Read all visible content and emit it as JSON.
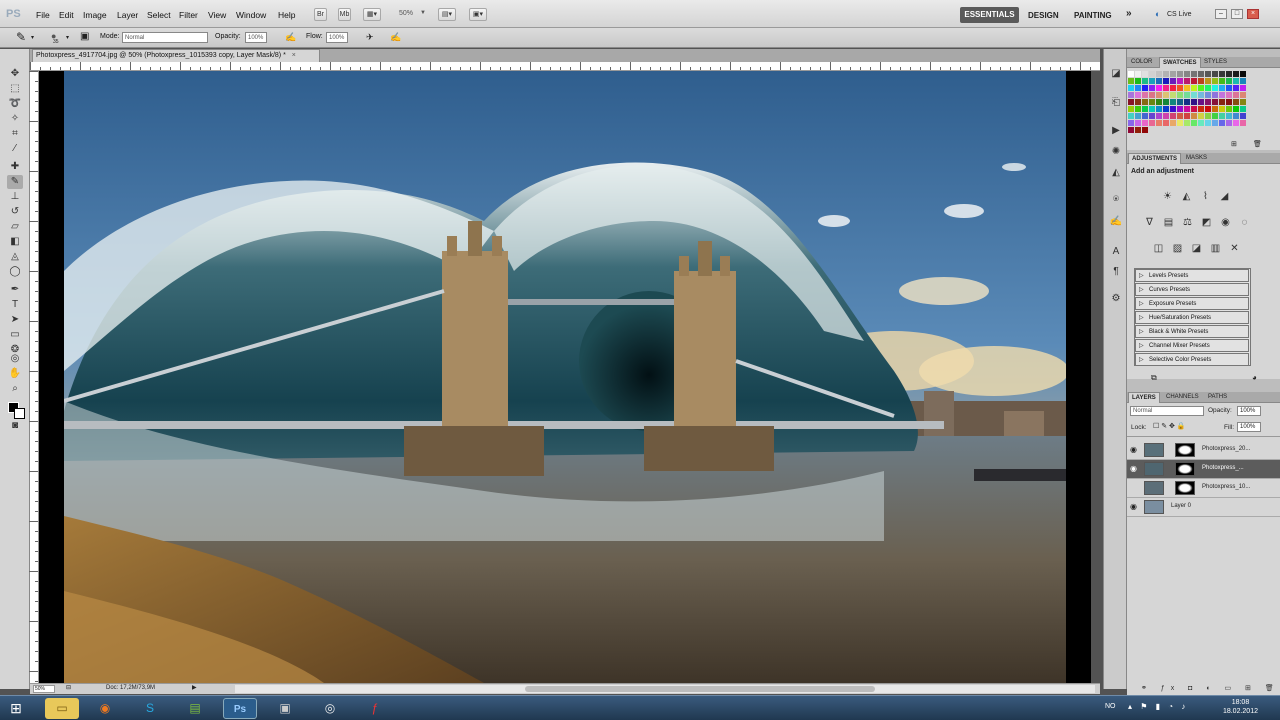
{
  "app": {
    "logo": "PS"
  },
  "menubar": {
    "items": [
      "File",
      "Edit",
      "Image",
      "Layer",
      "Select",
      "Filter",
      "View",
      "Window",
      "Help"
    ],
    "zoom_value": "50%",
    "workspaces": {
      "active": "ESSENTIALS",
      "design": "DESIGN",
      "painting": "PAINTING",
      "more": "»"
    },
    "cs_live": "CS Live"
  },
  "options": {
    "brush_size": "35",
    "mode_label": "Mode:",
    "mode_value": "Normal",
    "opacity_label": "Opacity:",
    "opacity_value": "100%",
    "flow_label": "Flow:",
    "flow_value": "100%"
  },
  "document": {
    "tab_title": "Photoxpress_4917704.jpg @ 50% (Photoxpress_1015393 copy, Layer Mask/8) *",
    "close": "×"
  },
  "status": {
    "zoom": "50%",
    "doc_size": "Doc: 17,2M/73,9M"
  },
  "panels": {
    "color_tabs": [
      "COLOR",
      "SWATCHES",
      "STYLES"
    ],
    "adjust_tabs": [
      "ADJUSTMENTS",
      "MASKS"
    ],
    "adjust_title": "Add an adjustment",
    "presets": [
      "Levels Presets",
      "Curves Presets",
      "Exposure Presets",
      "Hue/Saturation Presets",
      "Black & White Presets",
      "Channel Mixer Presets",
      "Selective Color Presets"
    ],
    "layer_tabs": [
      "LAYERS",
      "CHANNELS",
      "PATHS"
    ],
    "blend_mode": "Normal",
    "opacity_label": "Opacity:",
    "opacity_value": "100%",
    "lock_label": "Lock:",
    "fill_label": "Fill:",
    "fill_value": "100%",
    "layers": [
      {
        "name": "Photoxpress_20...",
        "visible": true,
        "selected": false
      },
      {
        "name": "Photoxpress_...",
        "visible": true,
        "selected": true
      },
      {
        "name": "Photoxpress_10...",
        "visible": false,
        "selected": false
      },
      {
        "name": "Layer 0",
        "visible": true,
        "selected": false
      }
    ]
  },
  "taskbar": {
    "language": "NO",
    "time": "18:08",
    "date": "18.02.2012"
  }
}
